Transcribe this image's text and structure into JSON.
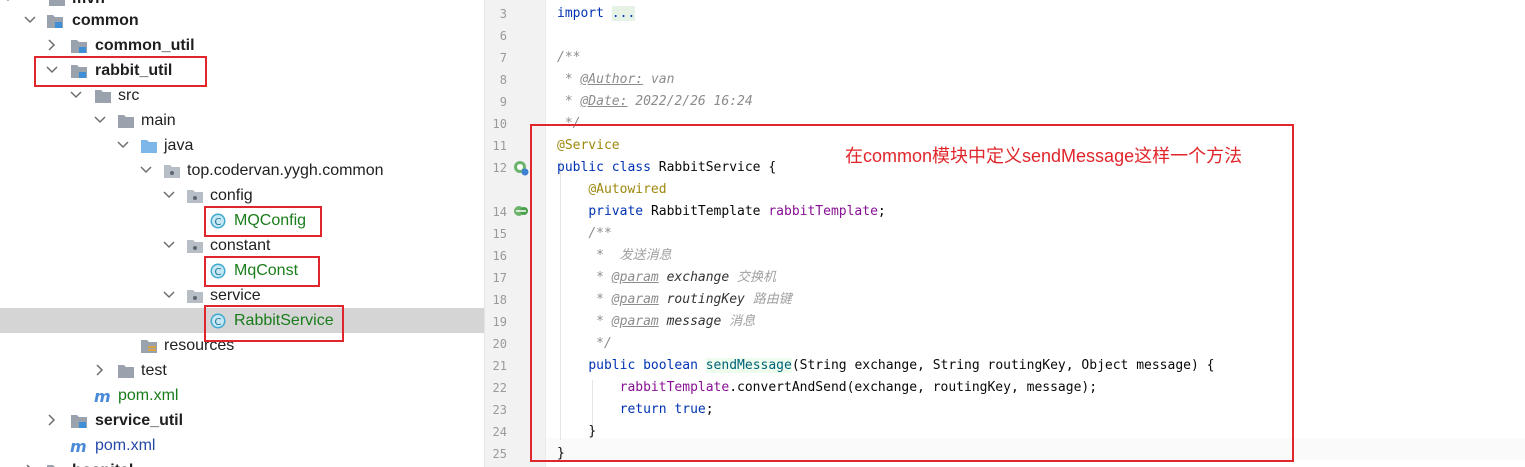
{
  "tree": {
    "top_partial": "mvn",
    "items": [
      {
        "label": "common",
        "bold": true
      },
      {
        "label": "common_util",
        "bold": true
      },
      {
        "label": "rabbit_util",
        "bold": true
      },
      {
        "label": "src"
      },
      {
        "label": "main"
      },
      {
        "label": "java"
      },
      {
        "label": "top.codervan.yygh.common"
      },
      {
        "label": "config"
      },
      {
        "label": "MQConfig"
      },
      {
        "label": "constant"
      },
      {
        "label": "MqConst"
      },
      {
        "label": "service"
      },
      {
        "label": "RabbitService"
      },
      {
        "label": "resources"
      },
      {
        "label": "test"
      },
      {
        "label": "pom.xml"
      },
      {
        "label": "service_util",
        "bold": true
      },
      {
        "label": "pom.xml"
      }
    ],
    "bottom_partial": "hospital"
  },
  "editor": {
    "line_numbers": [
      "3",
      "6",
      "7",
      "8",
      "9",
      "10",
      "11",
      "12",
      "14",
      "15",
      "16",
      "17",
      "18",
      "19",
      "20",
      "21",
      "22",
      "23",
      "24",
      "25"
    ],
    "import_kw": "import",
    "import_fold": "...",
    "doc_open": "/**",
    "doc_star": "*",
    "author_tag": "@Author:",
    "author_value": "van",
    "date_tag": "@Date:",
    "date_value": "2022/2/26 16:24",
    "doc_close": "*/",
    "service_ann": "@Service",
    "kw_public": "public",
    "kw_class": "class",
    "class_name": "RabbitService {",
    "autowired_ann": "@Autowired",
    "kw_private": "private",
    "field_type": "RabbitTemplate",
    "field_name": "rabbitTemplate",
    "semicolon": ";",
    "doc_desc": "发送消息",
    "param_tag": "@param",
    "param1_name": "exchange",
    "param1_desc": "交换机",
    "param2_name": "routingKey",
    "param2_desc": "路由键",
    "param3_name": "message",
    "param3_desc": "消息",
    "kw_boolean": "boolean",
    "method_name": "sendMessage",
    "method_params": "(String exchange, String routingKey, Object message) {",
    "call_target": "rabbitTemplate",
    "call_rest": ".convertAndSend(exchange, routingKey, message);",
    "kw_return": "return",
    "kw_true": "true",
    "close_brace": "}"
  },
  "annotation": {
    "text": "在common模块中定义sendMessage这样一个方法",
    "color": "#e0262b"
  },
  "colors": {
    "keyword": "#0033b3",
    "annotation": "#9e880d",
    "field": "#871094",
    "method_decl": "#00627a",
    "comment": "#8c8c8c",
    "green_class": "#1a7c1a",
    "red_box": "#e0262b",
    "selection": "#d5d5d5"
  }
}
